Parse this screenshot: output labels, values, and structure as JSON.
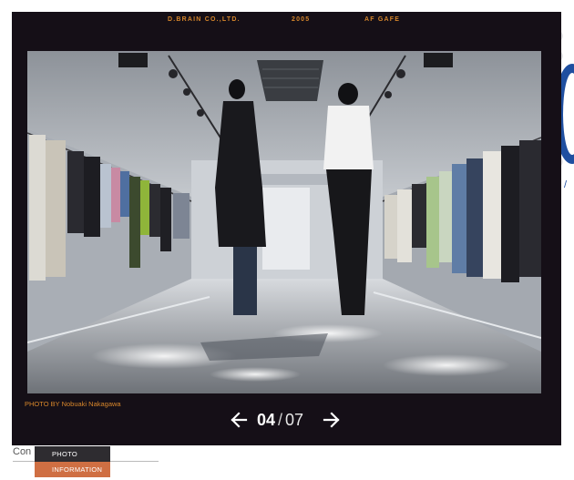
{
  "header": {
    "company": "D.BRAIN CO.,LTD.",
    "year": "2005",
    "project": "AF GAFE"
  },
  "photo": {
    "credit": "PHOTO BY Nobuaki Nakagawa",
    "subject": "boutique interior"
  },
  "pager": {
    "current": "04",
    "separator": "/",
    "total": "07",
    "prev_icon": "arrow-left-icon",
    "next_icon": "arrow-right-icon"
  },
  "background": {
    "partial_text": "Con"
  },
  "tabs": [
    {
      "label": "PHOTO"
    },
    {
      "label": "INFORMATION"
    }
  ],
  "colors": {
    "frame": "#150f17",
    "accent_orange": "#d7862b",
    "tab_dark": "#2e2c30",
    "tab_orange": "#cf6f43",
    "background_blue": "#1f4fa0"
  }
}
